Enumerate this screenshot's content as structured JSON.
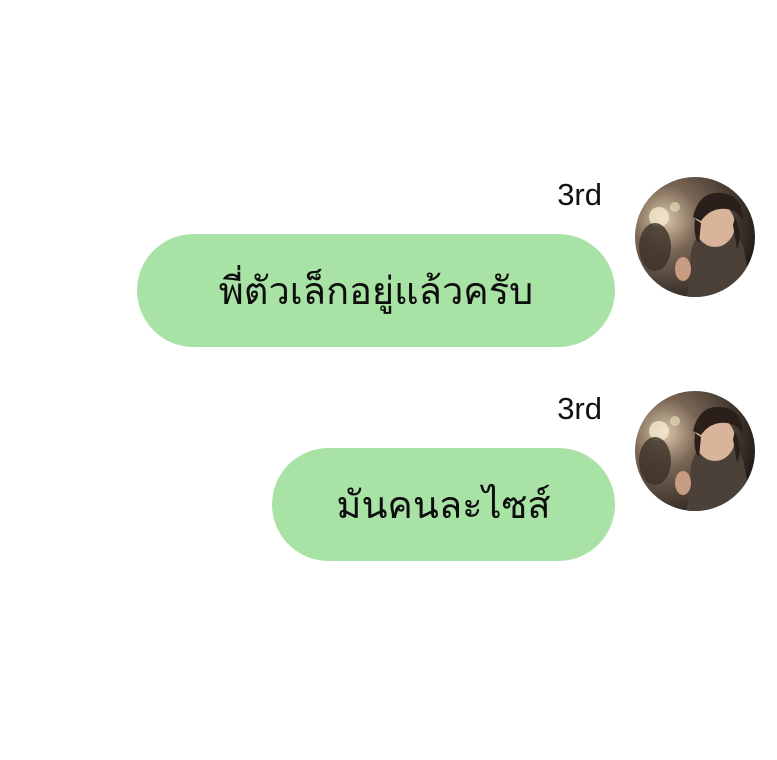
{
  "theme": {
    "bubble_color": "#a8e3a5",
    "text_color": "#0d0d0d",
    "background": "#ffffff"
  },
  "messages": [
    {
      "sender": "3rd",
      "text": "พี่ตัวเล็กอยู่แล้วครับ",
      "avatar_icon": "user-avatar-photo"
    },
    {
      "sender": "3rd",
      "text": "มันคนละไซส์",
      "avatar_icon": "user-avatar-photo"
    }
  ]
}
